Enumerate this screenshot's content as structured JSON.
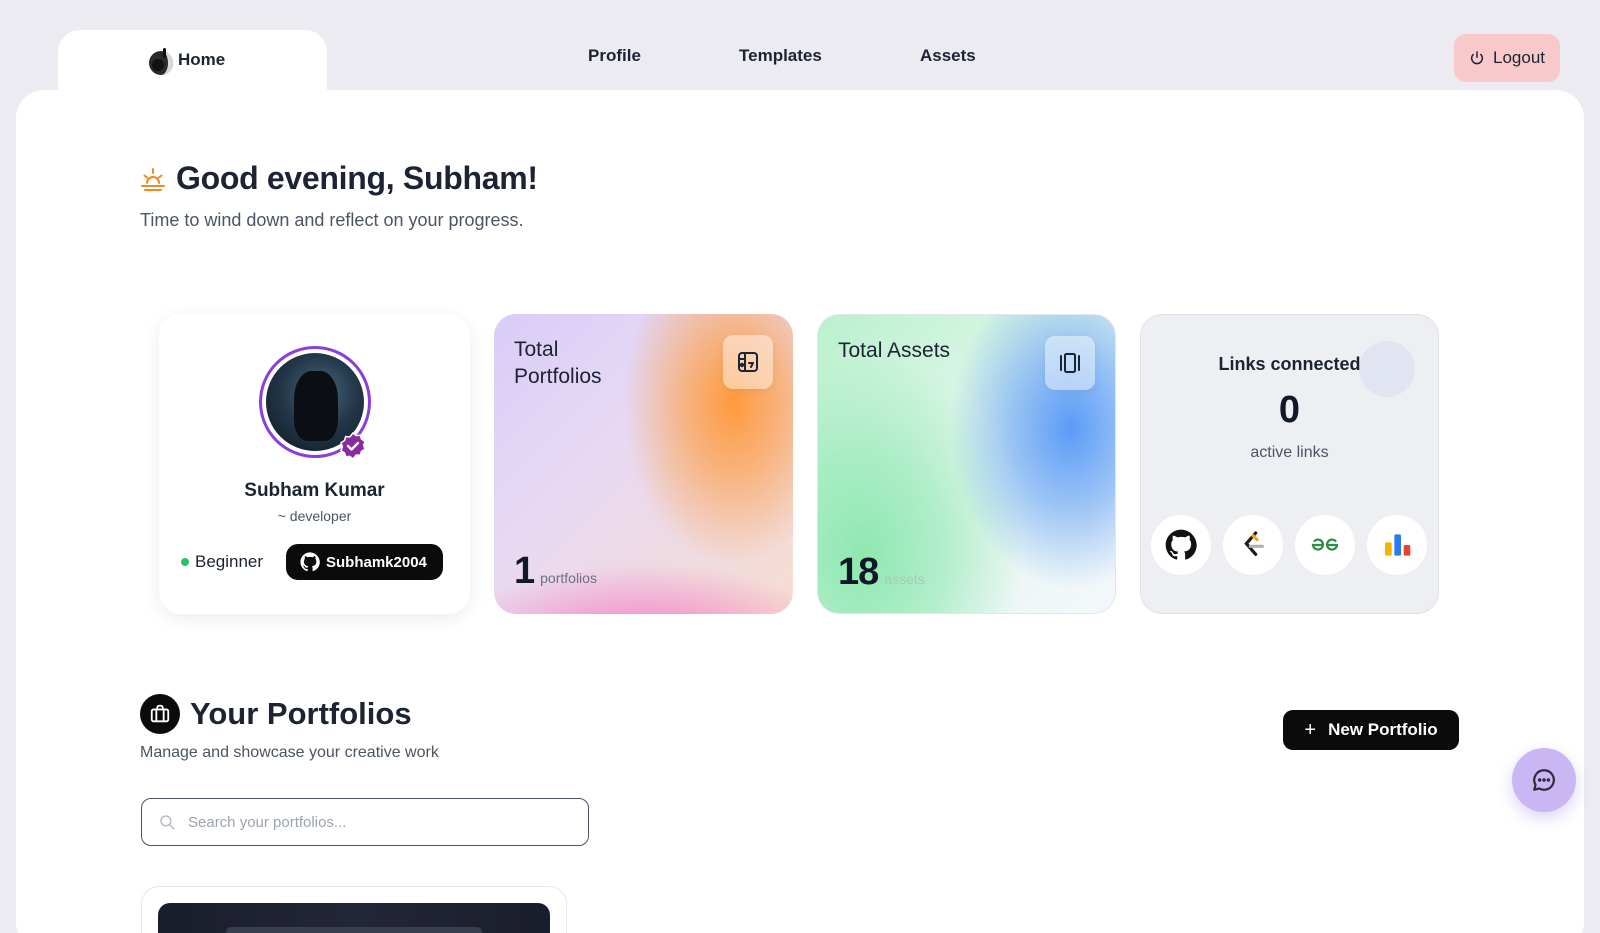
{
  "nav": {
    "home_label": "Home",
    "links": [
      "Profile",
      "Templates",
      "Assets"
    ],
    "logout_label": "Logout"
  },
  "greeting": {
    "title": "Good evening, Subham!",
    "subtitle": "Time to wind down and reflect on your progress."
  },
  "profile": {
    "name": "Subham Kumar",
    "role": "~ developer",
    "level": "Beginner",
    "github_handle": "Subhamk2004"
  },
  "stats": {
    "portfolios": {
      "title": "Total Portfolios",
      "value": "1",
      "unit": "portfolios"
    },
    "assets": {
      "title": "Total Assets",
      "value": "18",
      "unit": "assets"
    }
  },
  "links": {
    "title": "Links connected",
    "count": "0",
    "label": "active links",
    "icons": [
      "github-icon",
      "leetcode-icon",
      "geeksforgeeks-icon",
      "analytics-icon"
    ]
  },
  "portfolios_section": {
    "title": "Your Portfolios",
    "subtitle": "Manage and showcase your creative work",
    "new_button_label": "New Portfolio",
    "search_placeholder": "Search your portfolios..."
  },
  "colors": {
    "accent_purple": "#8b3fd9",
    "logout_bg": "#f8c9cb",
    "status_green": "#22c55e",
    "chat_fab_bg": "#c9b6f2"
  }
}
